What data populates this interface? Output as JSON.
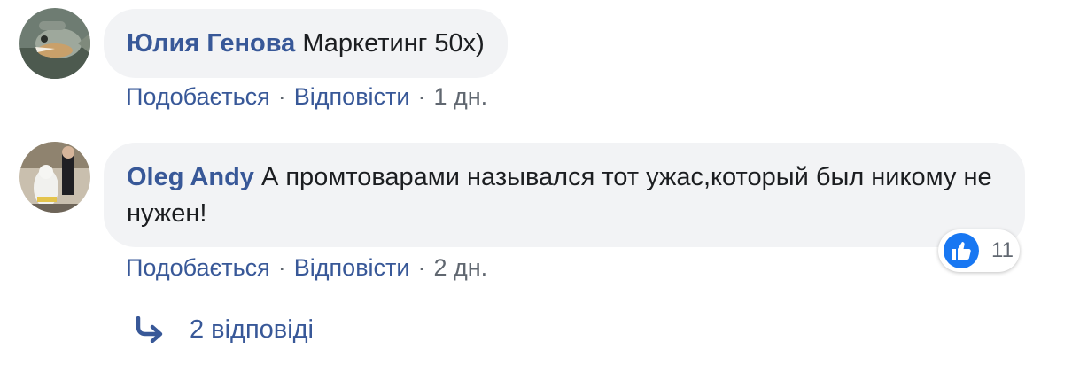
{
  "comments": [
    {
      "author": "Юлия Генова",
      "text": "Маркетинг 50х)",
      "actions": {
        "like": "Подобається",
        "reply": "Відповісти",
        "time": "1 дн."
      }
    },
    {
      "author": "Oleg Andy",
      "text": "А промтоварами назывался тот ужас,который был никому не нужен!",
      "actions": {
        "like": "Подобається",
        "reply": "Відповісти",
        "time": "2 дн."
      },
      "reactions": {
        "icon": "thumbs-up-icon",
        "count": "11",
        "color": "#1877f2"
      }
    }
  ],
  "replies_link": {
    "icon": "reply-arrow-icon",
    "label": "2 відповіді"
  },
  "colors": {
    "link": "#385898",
    "bubble": "#f2f3f5",
    "meta": "#606770"
  }
}
